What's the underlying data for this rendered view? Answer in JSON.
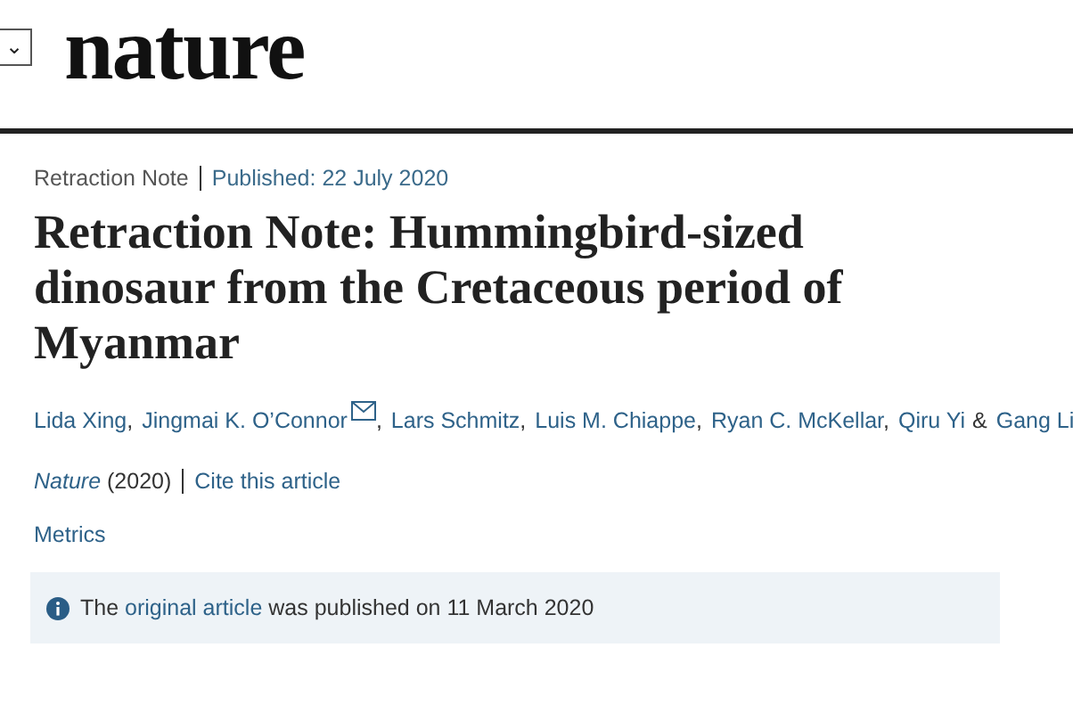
{
  "header": {
    "menu_toggle": "⌄",
    "logo": "nature"
  },
  "article": {
    "type": "Retraction Note",
    "published": "Published: 22 July 2020",
    "title": "Retraction Note: Hummingbird-sized dinosaur from the Cretaceous period of Myanmar",
    "authors": [
      {
        "name": "Lida Xing",
        "sep": ",",
        "email": false
      },
      {
        "name": "Jingmai K. O’Connor",
        "sep": ",",
        "email": true
      },
      {
        "name": "Lars Schmitz",
        "sep": ",",
        "email": false
      },
      {
        "name": "Luis M. Chiappe",
        "sep": ",",
        "email": false
      },
      {
        "name": "Ryan C. McKellar",
        "sep": ",",
        "email": false
      },
      {
        "name": "Qiru Yi",
        "sep": "&",
        "email": false
      },
      {
        "name": "Gang Li",
        "email": false
      }
    ],
    "journal": "Nature",
    "year": "(2020)",
    "cite": "Cite this article",
    "metrics": "Metrics",
    "notice": {
      "before": "The",
      "link": "original article",
      "after": "was published on 11 March 2020"
    }
  }
}
